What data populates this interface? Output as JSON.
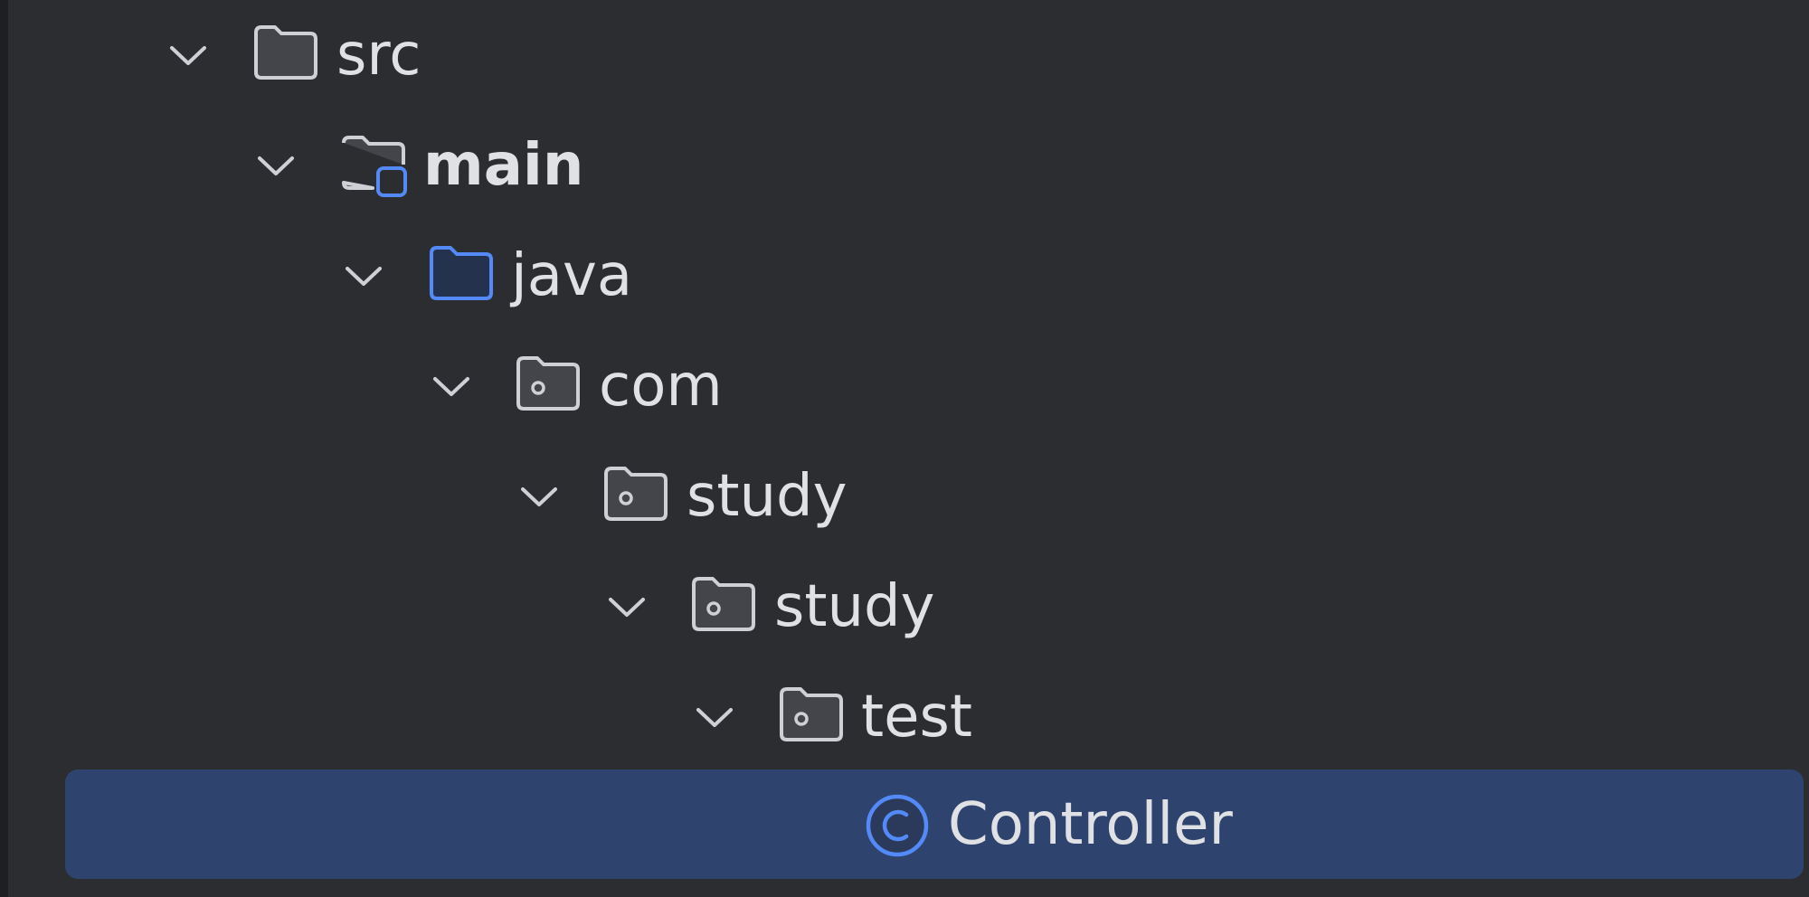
{
  "project_tree": {
    "items": [
      {
        "label": "src",
        "icon": "folder-icon",
        "expanded": true
      },
      {
        "label": "main",
        "icon": "source-set-folder-icon",
        "expanded": true
      },
      {
        "label": "java",
        "icon": "sources-root-folder-icon",
        "expanded": true
      },
      {
        "label": "com",
        "icon": "package-icon",
        "expanded": true
      },
      {
        "label": "study",
        "icon": "package-icon",
        "expanded": true
      },
      {
        "label": "study",
        "icon": "package-icon",
        "expanded": true
      },
      {
        "label": "test",
        "icon": "package-icon",
        "expanded": true
      },
      {
        "label": "Controller",
        "icon": "class-icon",
        "selected": true
      }
    ]
  },
  "colors": {
    "background": "#2b2d30",
    "selection": "#2e436e",
    "text": "#dfe1e5",
    "icon_stroke": "#ced0d6",
    "accent_blue": "#548af7"
  }
}
